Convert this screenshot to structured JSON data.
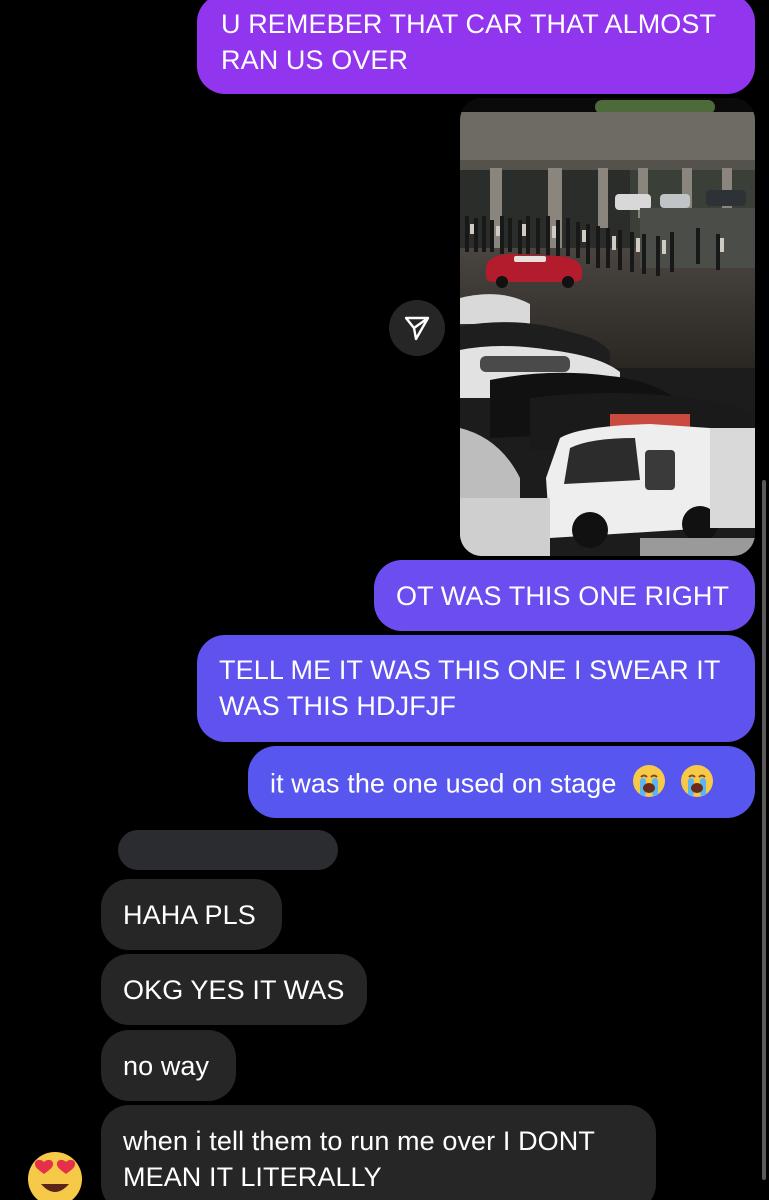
{
  "colors": {
    "background": "#000000",
    "received_bubble": "#262626",
    "sent_gradient_top": "#9b3cf0",
    "sent_gradient_bottom": "#5357ee"
  },
  "messages": [
    {
      "id": "m1",
      "from": "me",
      "text": "U REMEBER THAT CAR THAT ALMOST RAN US OVER"
    },
    {
      "id": "m2",
      "from": "me",
      "type": "video"
    },
    {
      "id": "m3",
      "from": "me",
      "text": "OT WAS THIS ONE RIGHT"
    },
    {
      "id": "m4",
      "from": "me",
      "text": "TELL ME IT WAS THIS ONE I SWEAR IT WAS THIS HDJFJF"
    },
    {
      "id": "m5",
      "from": "me",
      "text": "it was the one used on stage",
      "emoji": "loudly-crying-face-icon"
    },
    {
      "id": "m6",
      "from": "them",
      "text": "HAHA PLS"
    },
    {
      "id": "m7",
      "from": "them",
      "text": "OKG YES IT WAS"
    },
    {
      "id": "m8",
      "from": "them",
      "text": "no way"
    },
    {
      "id": "m9",
      "from": "them",
      "text": "when i tell them to run me over I DONT MEAN IT LITERALLY"
    }
  ],
  "share_icon": "send-arrow-icon",
  "avatar_icon": "smiling-face-heart-eyes-icon"
}
